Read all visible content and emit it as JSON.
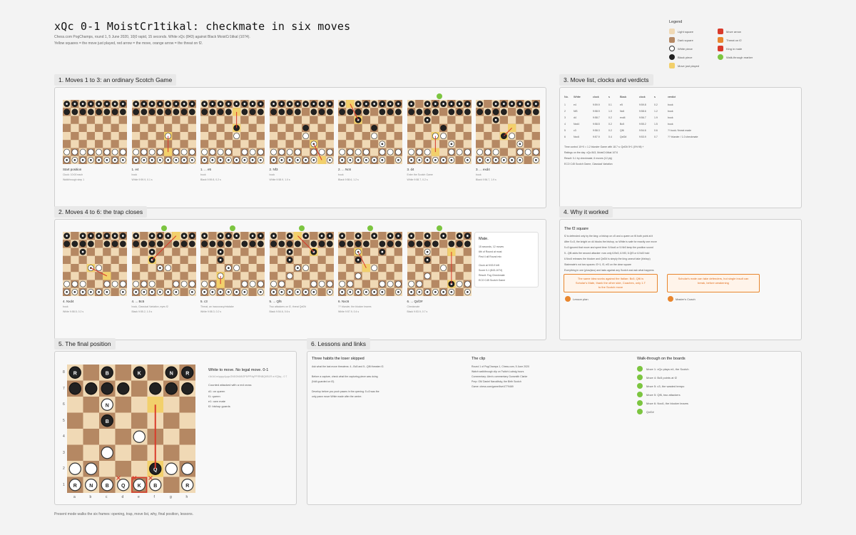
{
  "header": {
    "title": "xQc 0-1 MoistCr1tikal: checkmate in six moves",
    "subtitle1": "Chess.com PogChamps, round 1, 5 June 2020, 10|0 rapid, 15 seconds. White xQc (843) against Black MoistCr1tikal (1074).",
    "subtitle2": "Yellow squares = the move just played, red arrow = the move, orange arrow = the threat on f2."
  },
  "legend": {
    "title": "Legend",
    "items": [
      {
        "label": "Light square",
        "color": "#f0d9b5",
        "shape": "sq"
      },
      {
        "label": "Dark square",
        "color": "#b58863",
        "shape": "sq"
      },
      {
        "label": "White piece",
        "color": "#ffffff",
        "shape": "cr"
      },
      {
        "label": "Black piece",
        "color": "#222222",
        "shape": "cr"
      },
      {
        "label": "Move just played",
        "color": "#f2d06b",
        "shape": "sq"
      },
      {
        "label": "Move arrow",
        "color": "#d93a2b",
        "shape": "sq"
      },
      {
        "label": "Threat on f2",
        "color": "#e8862e",
        "shape": "sq"
      },
      {
        "label": "King in mate",
        "color": "#d93a2b",
        "shape": "sq"
      },
      {
        "label": "Walk-through marker",
        "color": "#7cc540",
        "shape": "cr"
      }
    ]
  },
  "sections": {
    "s1": "1. Moves 1 to 3: an ordinary Scotch Game",
    "s2": "2. Moves 4 to 6: the trap closes",
    "s3": "3. Move list, clocks and verdicts",
    "s4": "4. Why it worked",
    "s5": "5. The final position",
    "s6": "6. Lessons and links"
  },
  "row1": [
    {
      "cap": "Start position",
      "sub": "Clock: 10:00 each",
      "note": "Walkthrough step 1",
      "ply": 0
    },
    {
      "cap": "1. e4",
      "sub": "book",
      "note": "White 9:59.9, 0.1 s",
      "ply": 1
    },
    {
      "cap": "1. ... e5",
      "sub": "book",
      "note": "Black 9:59.8, 0.2 s",
      "ply": 2
    },
    {
      "cap": "2. Nf3",
      "sub": "book",
      "note": "White 9:58.9, 1.0 s",
      "ply": 3
    },
    {
      "cap": "2. ... Nc6",
      "sub": "book",
      "note": "Black 9:58.6, 1.2 s",
      "ply": 4
    },
    {
      "cap": "3. d4",
      "sub": "Enter the Scotch Game",
      "note": "White 9:58.7, 0.2 s",
      "ply": 5
    },
    {
      "cap": "3. ... exd4",
      "sub": "book",
      "note": "Black 9:56.7, 1.9 s",
      "ply": 6
    }
  ],
  "row2": [
    {
      "cap": "4. Nxd4",
      "sub": "book",
      "note": "White 9:58.5, 0.2 s",
      "ply": 7
    },
    {
      "cap": "4. ... Bc5",
      "sub": "book, Classical Variation, eyes f2",
      "note": "Black 9:55.2, 1.5 s",
      "ply": 8
    },
    {
      "cap": "5. c3",
      "sub": "Threat, an inaccuracy/mistake",
      "note": "White 9:58.3, 0.2 s",
      "ply": 9
    },
    {
      "cap": "5. ... Qf6",
      "sub": "Two attackers on f2, threat Qxf2#",
      "note": "Black 9:54.6, 0.6 s",
      "ply": 10
    },
    {
      "cap": "6. Nxc6",
      "sub": "?? blunder, the blocker leaves",
      "note": "White 9:57.9, 0.4 s",
      "ply": 11
    },
    {
      "cap": "6. ... Qxf2#",
      "sub": "Checkmate",
      "note": "Black 9:53.9, 0.7 s",
      "ply": 12
    }
  ],
  "mate": {
    "title": "Mate.",
    "lines": [
      "15 seconds, 12 moves",
      "6th of Round at most",
      "First 4 all Round mix",
      "Clock at 9:53.9 left",
      "Score 0-1 (843-1074)",
      "Result: Fog Checkmate",
      "ECO C45 Scotch Game"
    ]
  },
  "table": {
    "headers": [
      "No.",
      "White",
      "clock",
      "s",
      "Black",
      "clock",
      "s",
      "verdict"
    ],
    "rows": [
      [
        "1",
        "e4",
        "9:59.9",
        "0.1",
        "e5",
        "9:59.8",
        "0.2",
        "book"
      ],
      [
        "2",
        "Nf3",
        "9:58.9",
        "1.0",
        "Nc6",
        "9:58.6",
        "1.2",
        "book"
      ],
      [
        "3",
        "d4",
        "9:58.7",
        "0.2",
        "exd4",
        "9:56.7",
        "1.9",
        "book"
      ],
      [
        "4",
        "Nxd4",
        "9:58.5",
        "0.2",
        "Bc5",
        "9:55.2",
        "1.5",
        "book"
      ],
      [
        "5",
        "c3",
        "9:58.3",
        "0.2",
        "Qf6",
        "9:54.6",
        "0.6",
        "?! book / threat made"
      ],
      [
        "6",
        "Nxc6",
        "9:57.9",
        "0.4",
        "Qxf2#",
        "9:53.9",
        "0.7",
        "?? blunder / 1-0 checkmate"
      ]
    ],
    "notes": [
      "Time control 10+0 = 1.2 blunder Game with 18.7 s: Qxf2# 5+1 (0% fill) +",
      "Ratings on the day: xQc 843, MoistCr1tikal 1074",
      "Result: 0-1 by checkmate, 6 moves (12 ply)",
      "ECO C45 Scotch Game, Classical Variation"
    ]
  },
  "why": {
    "heading": "The f2 square",
    "lines": [
      "f2 is defended only by the king: a bishop on c5 and a queen on f6 both point at it",
      "After 5.c3, the knight on d4 blocks the bishop, so White is safe for exactly one move",
      "5.c3 ignored that move and spent time: 5.Nxc6 or 5.Nb3 keep the position sound",
      "5...Qf6 adds the second attacker: now only 6.Be3, 6.Nf3, 6.Qf3 or 6.Nd3 hold",
      "6.Nxc6 releases the blocker and Qxf2# is simply the king cannot take (bishop)",
      "Stalemate's not two spaces: f2+1, f3, ef3 on the clear square",
      "Everything in one (plus/plus) and lasts against any Scotch and ask what happens"
    ],
    "callout1": "The same idea works against the Italian: Bc5, Qf6 is Scholar's Mate, thank the other side, Coaches, only 1.T to the Scotch move",
    "callout2": "Scholar's mate can take defenders, but single insult can break, before weakening",
    "label1": "Lesson plan",
    "label2": "Master's Coach"
  },
  "finalpos": {
    "caption": "White to move. No legal move. 0-1",
    "fen_note": "r1b1k1nr/pppp1ppp/2N5/2b5/8/2P5/PP4qPP/RNBQKB1R w KQkq - 0 7",
    "counts_title": "Counted attacked with a red cross",
    "counts": [
      "d1: on queen",
      "f1: queen",
      "e1: own mate",
      "f2: bishop guards"
    ],
    "files": [
      "a",
      "b",
      "c",
      "d",
      "e",
      "f",
      "g",
      "h"
    ],
    "ranks": [
      "8",
      "7",
      "6",
      "5",
      "4",
      "3",
      "2",
      "1"
    ]
  },
  "lessons": {
    "c1title": "Three habits the loser skipped",
    "c1lines": [
      "Ask what the last move threatens: 4...Bc5 and 5...Qf6 threaten f2.",
      "",
      "Before a capture, check what the capturing piece was doing",
      "(Nd4 guarded on f2).",
      "",
      "Develop before you push pawns in the opening: 5.c3 was the",
      "only pawn move White made after the centre."
    ],
    "c2title": "The clip",
    "c2lines": [
      "Round 1 of PogChamps 1, Chess.com, 5 June 2020",
      "Watch walkthrough clip on Twitch Ludwig hours",
      "Commentary: Alex's commentary Gunsmith Clarke",
      "Prep: GM Daniel Naroditsky, the Birth Scotch",
      "Game: chess.com/game/live/4779469"
    ],
    "c3title": "Walk-through on the boards",
    "steps": [
      "Move 1: xQc plays e4, the Scotch",
      "Move 4: Bc5 points at f2",
      "Move 5: c3, the wasted tempo",
      "Move 5: Qf6, two attackers",
      "Move 6: Nxc6, the blocker leaves",
      "Qxf2#"
    ]
  },
  "footer": "Present mode walks the six frames: opening, trap, move list, why, final position, lessons.",
  "colors": {
    "light": "#f0d9b5",
    "dark": "#b58863",
    "hi": "#f2d06b",
    "arrow": "#d93a2b",
    "threat": "#e8862e",
    "green": "#7cc540"
  }
}
